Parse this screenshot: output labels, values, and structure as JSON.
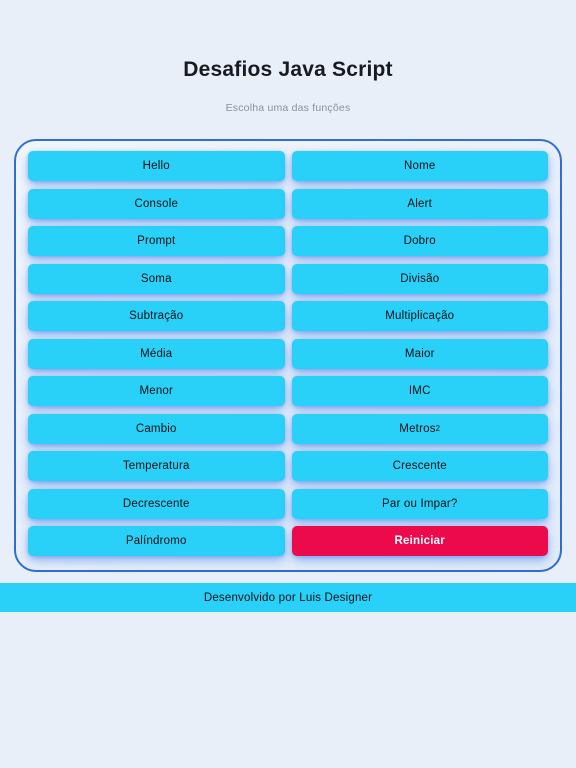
{
  "header": {
    "title": "Desafios Java Script",
    "subtitle": "Escolha uma das funções"
  },
  "colors": {
    "page_background": "#e9eff8",
    "panel_border": "#2f6fd0",
    "panel_background": "#eef3fb",
    "button": "#29d0f8",
    "button_text": "#101114",
    "reset_button": "#ec0a4c",
    "reset_button_text": "#ffffff",
    "subtitle_text": "#8b909a",
    "title_text": "#181a1f",
    "footer_background": "#29d0f8"
  },
  "buttons": [
    {
      "label": "Hello",
      "variant": "default"
    },
    {
      "label": "Nome",
      "variant": "default"
    },
    {
      "label": "Console",
      "variant": "default"
    },
    {
      "label": "Alert",
      "variant": "default"
    },
    {
      "label": "Prompt",
      "variant": "default"
    },
    {
      "label": "Dobro",
      "variant": "default"
    },
    {
      "label": "Soma",
      "variant": "default"
    },
    {
      "label": "Divisão",
      "variant": "default"
    },
    {
      "label": "Subtração",
      "variant": "default"
    },
    {
      "label": "Multiplicação",
      "variant": "default"
    },
    {
      "label": "Média",
      "variant": "default"
    },
    {
      "label": "Maior",
      "variant": "default"
    },
    {
      "label": "Menor",
      "variant": "default"
    },
    {
      "label": "IMC",
      "variant": "default"
    },
    {
      "label": "Cambio",
      "variant": "default"
    },
    {
      "label": "Metros²",
      "variant": "default"
    },
    {
      "label": "Temperatura",
      "variant": "default"
    },
    {
      "label": "Crescente",
      "variant": "default"
    },
    {
      "label": "Decrescente",
      "variant": "default"
    },
    {
      "label": "Par ou Impar?",
      "variant": "default"
    },
    {
      "label": "Palíndromo",
      "variant": "default"
    },
    {
      "label": "Reiniciar",
      "variant": "reset"
    }
  ],
  "footer": {
    "credit": "Desenvolvido por Luis Designer"
  }
}
